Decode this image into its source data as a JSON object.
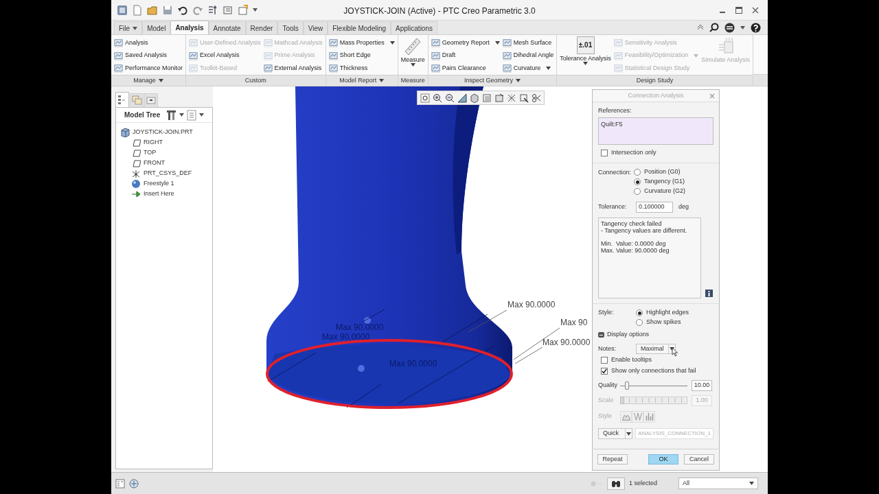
{
  "window": {
    "title": "JOYSTICK-JOIN (Active) - PTC Creo Parametric 3.0"
  },
  "ribbon_tabs": [
    {
      "label": "File",
      "dropdown": true,
      "selected": false
    },
    {
      "label": "Model",
      "selected": false
    },
    {
      "label": "Analysis",
      "selected": true
    },
    {
      "label": "Annotate",
      "selected": false
    },
    {
      "label": "Render",
      "selected": false
    },
    {
      "label": "Tools",
      "selected": false
    },
    {
      "label": "View",
      "selected": false
    },
    {
      "label": "Flexible Modeling",
      "selected": false
    },
    {
      "label": "Applications",
      "selected": false
    }
  ],
  "ribbon_groups": [
    {
      "label": "Manage",
      "dropdown": true,
      "columns": [
        [
          {
            "kind": "small",
            "label": "Analysis",
            "disabled": false
          },
          {
            "kind": "small",
            "label": "Saved Analysis",
            "disabled": false
          },
          {
            "kind": "small",
            "label": "Performance Monitor",
            "disabled": false
          }
        ]
      ]
    },
    {
      "label": "Custom",
      "dropdown": false,
      "columns": [
        [
          {
            "kind": "small",
            "label": "User-Defined Analysis",
            "disabled": true
          },
          {
            "kind": "small",
            "label": "Excel Analysis",
            "disabled": false
          },
          {
            "kind": "small",
            "label": "Toolkit-Based",
            "disabled": true
          }
        ],
        [
          {
            "kind": "small",
            "label": "Mathcad Analysis",
            "disabled": true
          },
          {
            "kind": "small",
            "label": "Prime Analysis",
            "disabled": true
          },
          {
            "kind": "small",
            "label": "External Analysis",
            "disabled": false
          }
        ]
      ]
    },
    {
      "label": "Model Report",
      "dropdown": true,
      "columns": [
        [
          {
            "kind": "small",
            "label": "Mass Properties",
            "dropdown": true,
            "disabled": false
          },
          {
            "kind": "small",
            "label": "Short Edge",
            "disabled": false
          },
          {
            "kind": "small",
            "label": "Thickness",
            "disabled": false
          }
        ]
      ]
    },
    {
      "label": "Measure",
      "dropdown": false,
      "columns": [
        [
          {
            "kind": "large",
            "label": "Measure",
            "dropdown": true,
            "disabled": false
          }
        ]
      ]
    },
    {
      "label": "Inspect Geometry",
      "dropdown": true,
      "columns": [
        [
          {
            "kind": "small",
            "label": "Geometry Report",
            "dropdown": true,
            "disabled": false
          },
          {
            "kind": "small",
            "label": "Draft",
            "disabled": false
          },
          {
            "kind": "small",
            "label": "Pairs Clearance",
            "disabled": false
          }
        ],
        [
          {
            "kind": "small",
            "label": "Mesh Surface",
            "disabled": false
          },
          {
            "kind": "small",
            "label": "Dihedral Angle",
            "disabled": false
          },
          {
            "kind": "small",
            "label": "Curvature",
            "dropdown": true,
            "disabled": false
          }
        ]
      ]
    },
    {
      "label": "Design Study",
      "dropdown": false,
      "columns": [
        [
          {
            "kind": "large",
            "label": "Tolerance Analysis",
            "icon_text": "±.01",
            "dropdown": true,
            "disabled": false
          }
        ],
        [
          {
            "kind": "small",
            "label": "Sensitivity Analysis",
            "disabled": true
          },
          {
            "kind": "small",
            "label": "Feasibility/Optimization",
            "dropdown": true,
            "disabled": true
          },
          {
            "kind": "small",
            "label": "Statistical Design Study",
            "disabled": true
          }
        ],
        [
          {
            "kind": "large",
            "label": "Simulate Analysis",
            "disabled": true
          }
        ]
      ]
    }
  ],
  "navigator": {
    "tabs": [
      {
        "selected": true
      },
      {
        "selected": false
      },
      {
        "selected": false
      }
    ],
    "title": "Model Tree",
    "tree": [
      {
        "kind": "part",
        "label": "JOYSTICK-JOIN.PRT",
        "children": [
          {
            "kind": "plane",
            "label": "RIGHT"
          },
          {
            "kind": "plane",
            "label": "TOP"
          },
          {
            "kind": "plane",
            "label": "FRONT"
          },
          {
            "kind": "csys",
            "label": "PRT_CSYS_DEF"
          },
          {
            "kind": "freestyle",
            "label": "Freestyle 1"
          },
          {
            "kind": "insert",
            "label": "Insert Here"
          }
        ]
      }
    ]
  },
  "notes": [
    "Max 90.0000",
    "Max 90",
    "Max 90.0000",
    "Max 90.0000",
    "Max 90.0000",
    "Max 90.0000"
  ],
  "dialog": {
    "title": "Connection Analysis",
    "references_label": "References:",
    "references": [
      "Quilt:F5"
    ],
    "intersection_only": {
      "label": "Intersection only",
      "checked": false
    },
    "connection_label": "Connection:",
    "connection": [
      {
        "label": "Position (G0)",
        "selected": false
      },
      {
        "label": "Tangency (G1)",
        "selected": true
      },
      {
        "label": "Curvature (G2)",
        "selected": false
      }
    ],
    "tolerance_label": "Tolerance:",
    "tolerance": "0.100000",
    "tolerance_unit": "deg",
    "result": [
      [
        "Tangency check failed",
        "- Tangency values are different."
      ],
      [
        "Min.  Value: 0.0000 deg",
        "Max. Value: 90.0000 deg"
      ]
    ],
    "style_label": "Style:",
    "style": [
      {
        "label": "Highlight edges",
        "selected": true
      },
      {
        "label": "Show spikes",
        "selected": false
      }
    ],
    "display_options": {
      "label": "Display options",
      "expanded": true
    },
    "notes_label": "Notes:",
    "notes_value": "Maximal",
    "checkboxes": [
      {
        "label": "Enable tooltips",
        "checked": false
      },
      {
        "label": "Show only connections that fail",
        "checked": true
      }
    ],
    "quality_label": "Quality",
    "quality": {
      "level": 0.1
    },
    "quality_value": "10.00",
    "scale_label": "Scale",
    "scale": {
      "level": 0
    },
    "scale_value": "1.00",
    "plot_style_label": "Style",
    "save_mode": "Quick",
    "analysis_name": "ANALYSIS_CONNECTION_1",
    "buttons": [
      "Repeat",
      "OK",
      "Cancel"
    ]
  },
  "status_bar": {
    "selection": "1 selected",
    "filter": "All"
  }
}
